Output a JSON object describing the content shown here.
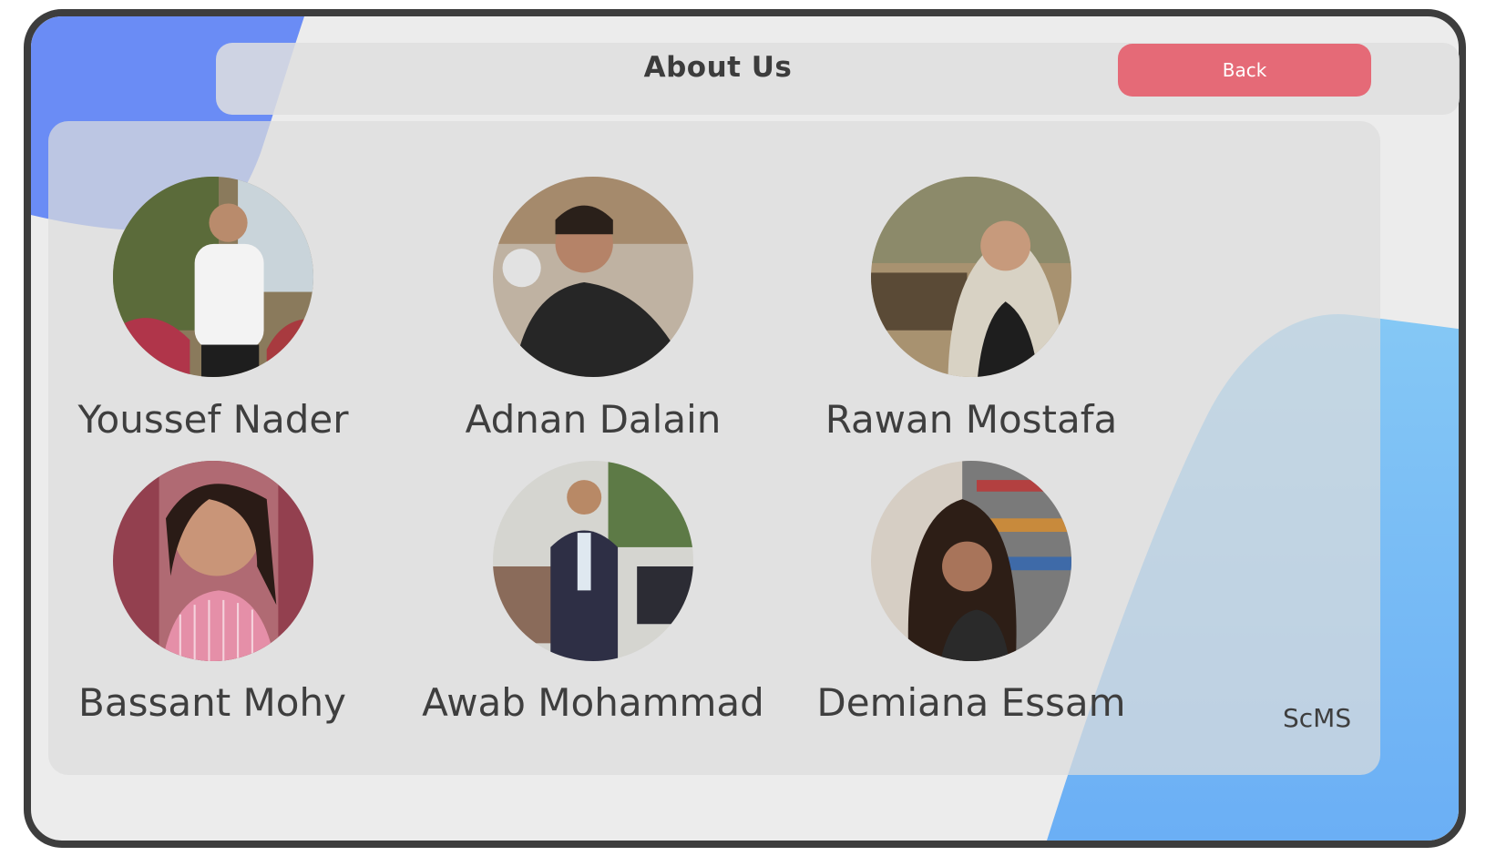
{
  "header": {
    "title": "About Us",
    "back_label": "Back"
  },
  "members": [
    {
      "name": "Youssef Nader"
    },
    {
      "name": "Adnan Dalain"
    },
    {
      "name": "Rawan Mostafa"
    },
    {
      "name": "Bassant Mohy"
    },
    {
      "name": "Awab Mohammad"
    },
    {
      "name": "Demiana Essam"
    }
  ],
  "brand": "ScMS",
  "colors": {
    "accent_back": "#e56a77",
    "blob_top_left": "#6a8cf5",
    "blob_bottom_right": "#7cc0f5",
    "frame": "#3d3d3d",
    "panel": "#e0e0e0"
  }
}
